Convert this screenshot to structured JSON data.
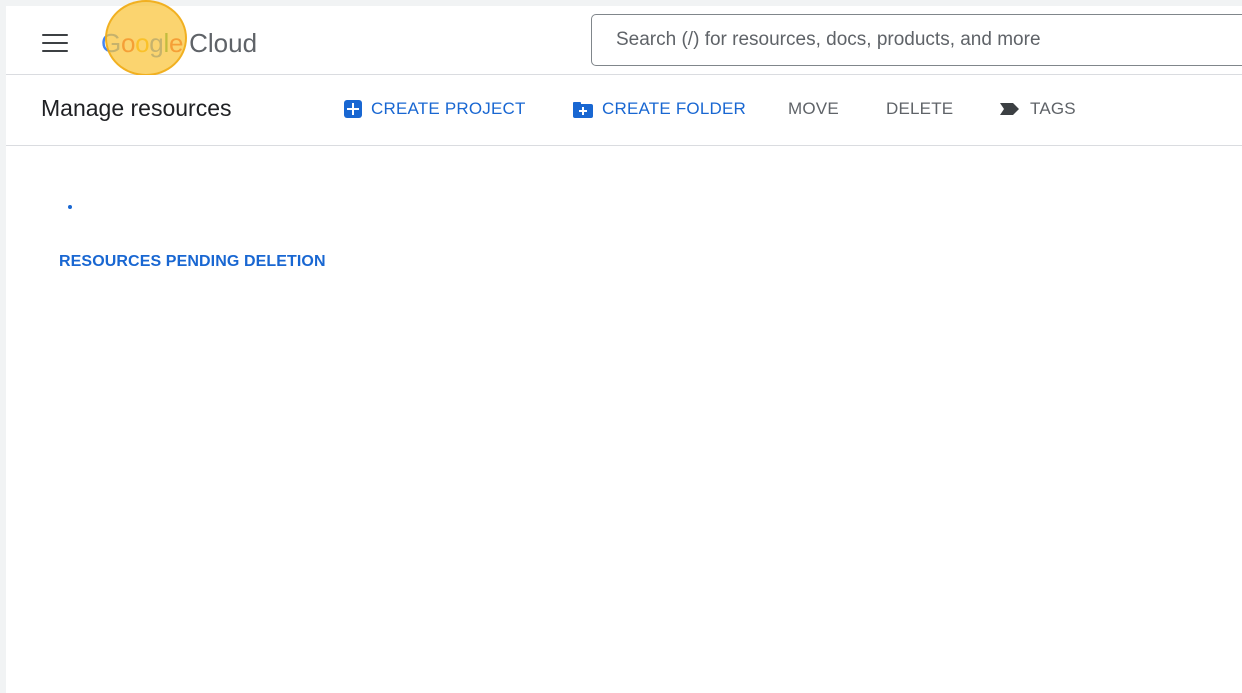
{
  "header": {
    "logo": {
      "google_letters": [
        "G",
        "o",
        "o",
        "g",
        "l",
        "e"
      ],
      "product": "Cloud"
    },
    "search": {
      "placeholder": "Search (/) for resources, docs, products, and more",
      "value": ""
    }
  },
  "toolbar": {
    "title": "Manage resources",
    "create_project_label": "CREATE PROJECT",
    "create_folder_label": "CREATE FOLDER",
    "move_label": "MOVE",
    "delete_label": "DELETE",
    "tags_label": "TAGS"
  },
  "content": {
    "pending_deletion_label": "RESOURCES PENDING DELETION"
  },
  "icons": {
    "menu": "hamburger-menu-icon",
    "create_project": "add-box-icon",
    "create_folder": "create-new-folder-icon",
    "tags": "tag-icon"
  },
  "colors": {
    "accent": "#1967d2",
    "highlight": "#f9c438"
  }
}
